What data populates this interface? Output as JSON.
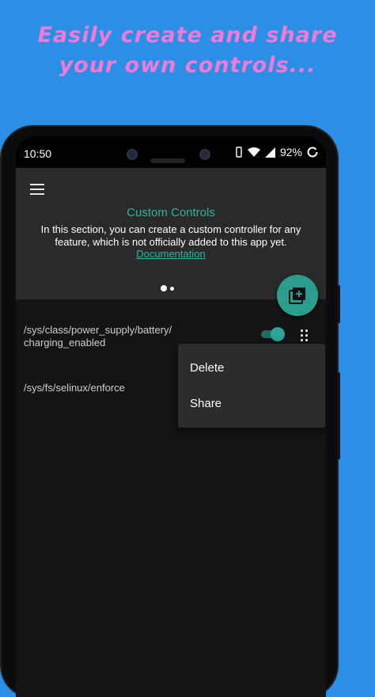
{
  "promo": {
    "line1": "Easily create and share",
    "line2": "your own controls..."
  },
  "status_bar": {
    "time": "10:50",
    "battery": "92%",
    "icons": [
      "vibrate-icon",
      "wifi-icon",
      "signal-icon",
      "battery-ring-icon"
    ]
  },
  "header": {
    "menu_icon": "hamburger-menu-icon",
    "title": "Custom Controls",
    "description": "In this section, you can create a custom controller for any feature, which is not officially added to this app yet.",
    "link": "Documentation",
    "page_indicator": {
      "pages": 2,
      "current": 1
    }
  },
  "fab": {
    "icon": "add-library-icon",
    "color": "#2a9d8f"
  },
  "controls": [
    {
      "path": "/sys/class/power_supply/battery/\ncharging_enabled",
      "enabled": true
    },
    {
      "path": "/sys/fs/selinux/enforce"
    }
  ],
  "context_menu": {
    "items": [
      "Delete",
      "Share"
    ]
  },
  "colors": {
    "background": "#2b8fe6",
    "promo_text": "#f07ad8",
    "accent": "#31b3a5",
    "surface": "#2a2a2a",
    "list_bg": "#141414"
  }
}
